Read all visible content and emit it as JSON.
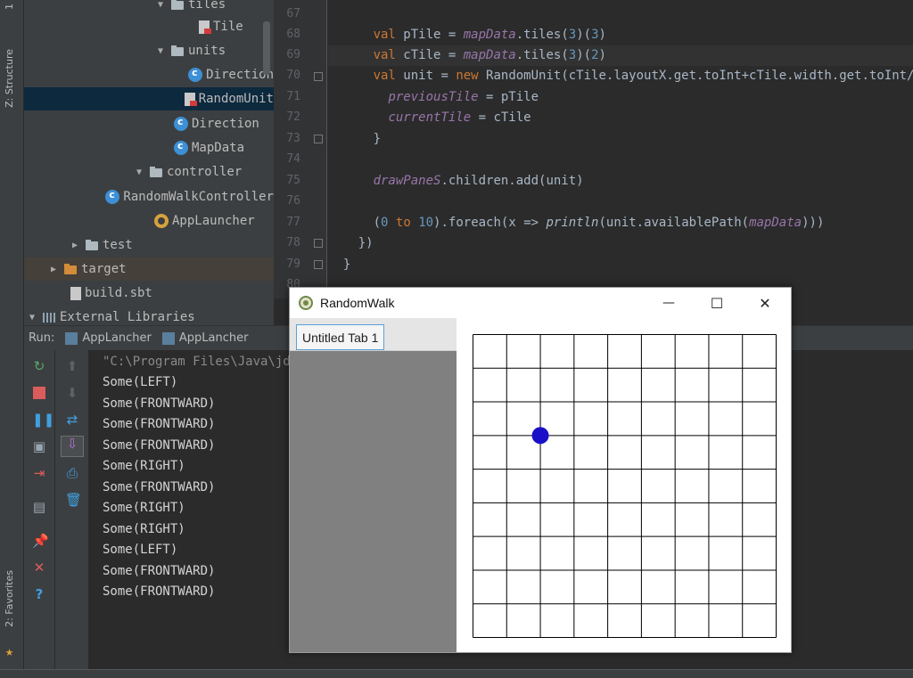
{
  "left_strip": {
    "structure_label": "Z: Structure",
    "favorites_label": "2: Favorites",
    "project_label": "1"
  },
  "project_tree": {
    "items": [
      {
        "label": "tiles"
      },
      {
        "label": "Tile"
      },
      {
        "label": "units"
      },
      {
        "label": "Direction"
      },
      {
        "label": "RandomUnit"
      },
      {
        "label": "Direction"
      },
      {
        "label": "MapData"
      },
      {
        "label": "controller"
      },
      {
        "label": "RandomWalkController"
      },
      {
        "label": "AppLauncher"
      },
      {
        "label": "test"
      },
      {
        "label": "target"
      },
      {
        "label": "build.sbt"
      },
      {
        "label": "External Libraries"
      }
    ]
  },
  "editor": {
    "line_numbers": [
      "67",
      "68",
      "69",
      "70",
      "71",
      "72",
      "73",
      "74",
      "75",
      "76",
      "77",
      "78",
      "79",
      "80"
    ]
  },
  "run_panel": {
    "run_label": "Run:",
    "tabs": [
      {
        "label": "AppLancher"
      },
      {
        "label": "AppLancher"
      }
    ],
    "console": [
      "\"C:\\Program Files\\Java\\jdk1.",
      "Some(LEFT)",
      "Some(FRONTWARD)",
      "Some(FRONTWARD)",
      "Some(FRONTWARD)",
      "Some(RIGHT)",
      "Some(FRONTWARD)",
      "Some(RIGHT)",
      "Some(RIGHT)",
      "Some(LEFT)",
      "Some(FRONTWARD)",
      "Some(FRONTWARD)"
    ]
  },
  "app_window": {
    "title": "RandomWalk",
    "minimize_symbol": "—",
    "maximize_symbol": "☐",
    "close_symbol": "✕",
    "tab_label": "Untitled Tab 1",
    "grid": {
      "columns": 9,
      "rows": 9,
      "unit_column": 2,
      "unit_row": 3,
      "unit_color": "#1a10c8",
      "line_color": "#000000"
    }
  },
  "colors": {
    "accent": "#3d8fd6",
    "keyword": "#cc7832",
    "field": "#9876aa",
    "number": "#6897bb"
  }
}
